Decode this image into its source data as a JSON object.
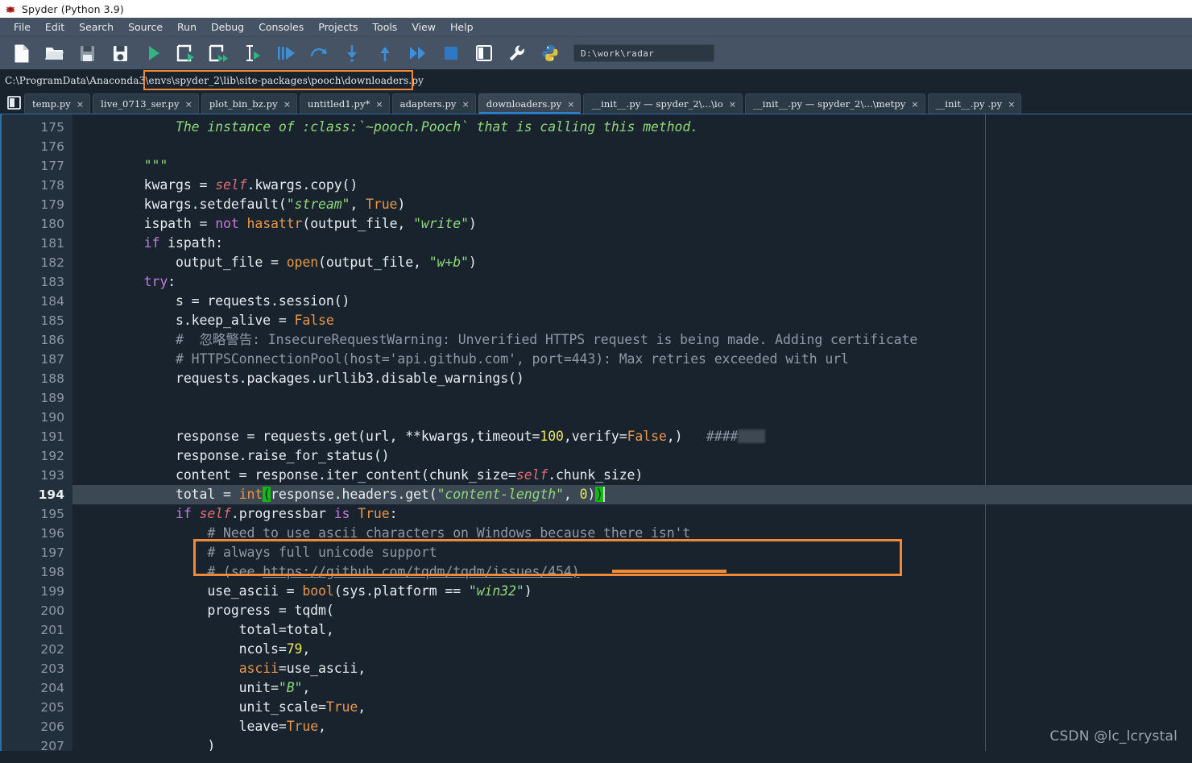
{
  "window": {
    "title": "Spyder (Python 3.9)",
    "logo_icon": "spyder-logo-icon"
  },
  "menubar": {
    "items": [
      {
        "label": "File"
      },
      {
        "label": "Edit"
      },
      {
        "label": "Search"
      },
      {
        "label": "Source"
      },
      {
        "label": "Run"
      },
      {
        "label": "Debug"
      },
      {
        "label": "Consoles"
      },
      {
        "label": "Projects"
      },
      {
        "label": "Tools"
      },
      {
        "label": "View"
      },
      {
        "label": "Help"
      }
    ]
  },
  "toolbar": {
    "buttons": [
      {
        "name": "new-file-icon",
        "title": "New file"
      },
      {
        "name": "open-file-icon",
        "title": "Open file"
      },
      {
        "name": "save-file-icon",
        "title": "Save file"
      },
      {
        "name": "save-all-icon",
        "title": "Save all"
      },
      {
        "name": "run-file-icon",
        "title": "Run file"
      },
      {
        "name": "run-cell-icon",
        "title": "Run current cell"
      },
      {
        "name": "run-cell-advance-icon",
        "title": "Run current cell and go to next one"
      },
      {
        "name": "run-selection-icon",
        "title": "Run selection"
      },
      {
        "name": "debug-file-icon",
        "title": "Debug file"
      },
      {
        "name": "step-over-icon",
        "title": "Run current line"
      },
      {
        "name": "step-into-icon",
        "title": "Step into function"
      },
      {
        "name": "step-return-icon",
        "title": "Run until current function returns"
      },
      {
        "name": "continue-icon",
        "title": "Continue execution"
      },
      {
        "name": "stop-debug-icon",
        "title": "Stop debugging"
      },
      {
        "name": "maximize-pane-icon",
        "title": "Maximize current pane"
      },
      {
        "name": "preferences-icon",
        "title": "Preferences"
      },
      {
        "name": "python-path-manager-icon",
        "title": "PYTHONPATH manager"
      }
    ],
    "working_directory": "D:\\work\\radar"
  },
  "path_strip": {
    "prefix": "C:\\ProgramData\\Anaconda3\\envs",
    "highlighted": "\\spyder_2\\lib\\site-packages\\pooch\\downloaders.py",
    "full": "C:\\ProgramData\\Anaconda3\\envs\\spyder_2\\lib\\site-packages\\pooch\\downloaders.py"
  },
  "tabbar": {
    "browse_icon": "browse-tabs-icon",
    "tabs": [
      {
        "label": "temp.py",
        "active": false,
        "modified": false
      },
      {
        "label": "live_0713_ser.py",
        "active": false,
        "modified": false
      },
      {
        "label": "plot_bin_bz.py",
        "active": false,
        "modified": false
      },
      {
        "label": "untitled1.py*",
        "active": false,
        "modified": true
      },
      {
        "label": "adapters.py",
        "active": false,
        "modified": false
      },
      {
        "label": "downloaders.py",
        "active": true,
        "modified": false
      },
      {
        "label": "__init__.py — spyder_2\\...\\io",
        "active": false,
        "modified": false
      },
      {
        "label": "__init__.py — spyder_2\\...\\metpy",
        "active": false,
        "modified": false
      },
      {
        "label": "__init__.py .py",
        "active": false,
        "modified": false
      }
    ],
    "close_glyph": "×"
  },
  "editor": {
    "first_line": 175,
    "current_line": 194,
    "line_numbers": [
      175,
      176,
      177,
      178,
      179,
      180,
      181,
      182,
      183,
      184,
      185,
      186,
      187,
      188,
      189,
      190,
      191,
      192,
      193,
      194,
      195,
      196,
      197,
      198,
      199,
      200,
      201,
      202,
      203,
      204,
      205,
      206,
      207
    ],
    "lines": [
      {
        "n": 175,
        "text": "            The instance of :class:`~pooch.Pooch` that is calling this method."
      },
      {
        "n": 176,
        "text": ""
      },
      {
        "n": 177,
        "text": "        \"\"\""
      },
      {
        "n": 178,
        "text": "        kwargs = self.kwargs.copy()"
      },
      {
        "n": 179,
        "text": "        kwargs.setdefault(\"stream\", True)"
      },
      {
        "n": 180,
        "text": "        ispath = not hasattr(output_file, \"write\")"
      },
      {
        "n": 181,
        "text": "        if ispath:"
      },
      {
        "n": 182,
        "text": "            output_file = open(output_file, \"w+b\")"
      },
      {
        "n": 183,
        "text": "        try:"
      },
      {
        "n": 184,
        "text": "            s = requests.session()"
      },
      {
        "n": 185,
        "text": "            s.keep_alive = False"
      },
      {
        "n": 186,
        "text": "            #  忽略警告: InsecureRequestWarning: Unverified HTTPS request is being made. Adding certificate"
      },
      {
        "n": 187,
        "text": "            # HTTPSConnectionPool(host='api.github.com', port=443): Max retries exceeded with url"
      },
      {
        "n": 188,
        "text": "            requests.packages.urllib3.disable_warnings()"
      },
      {
        "n": 189,
        "text": ""
      },
      {
        "n": 190,
        "text": ""
      },
      {
        "n": 191,
        "text": "            response = requests.get(url, **kwargs,timeout=100,verify=False,)   ####"
      },
      {
        "n": 192,
        "text": "            response.raise_for_status()"
      },
      {
        "n": 193,
        "text": "            content = response.iter_content(chunk_size=self.chunk_size)"
      },
      {
        "n": 194,
        "text": "            total = int(response.headers.get(\"content-length\", 0))"
      },
      {
        "n": 195,
        "text": "            if self.progressbar is True:"
      },
      {
        "n": 196,
        "text": "                # Need to use ascii characters on Windows because there isn't"
      },
      {
        "n": 197,
        "text": "                # always full unicode support"
      },
      {
        "n": 198,
        "text": "                # (see https://github.com/tqdm/tqdm/issues/454)"
      },
      {
        "n": 199,
        "text": "                use_ascii = bool(sys.platform == \"win32\")"
      },
      {
        "n": 200,
        "text": "                progress = tqdm("
      },
      {
        "n": 201,
        "text": "                    total=total,"
      },
      {
        "n": 202,
        "text": "                    ncols=79,"
      },
      {
        "n": 203,
        "text": "                    ascii=use_ascii,"
      },
      {
        "n": 204,
        "text": "                    unit=\"B\","
      },
      {
        "n": 205,
        "text": "                    unit_scale=True,"
      },
      {
        "n": 206,
        "text": "                    leave=True,"
      },
      {
        "n": 207,
        "text": "                )"
      }
    ],
    "redacted_comment": "####",
    "annotations": [
      {
        "name": "response-line-box",
        "color": "#ee8937",
        "target_line": 191
      },
      {
        "name": "timeout-underline",
        "color": "#ee8937",
        "target_text": "timeout=100"
      },
      {
        "name": "path-highlight-box",
        "color": "#ee8937",
        "target_text": "\\spyder_2\\lib\\site-packages\\pooch\\downloaders.py"
      }
    ]
  },
  "watermark": {
    "text": "CSDN @lc_lcrystal"
  },
  "colors": {
    "window_bg": "#19232d",
    "chrome_bg": "#455364",
    "gutter_bg": "#21303c",
    "current_line_bg": "#3c4854",
    "accent_blue": "#2a7fcf",
    "annotation_orange": "#ee8937",
    "text": "#e7ecf1",
    "comment": "#8d99a5",
    "string": "#8fd87a",
    "number": "#e8e45a",
    "keyword": "#c678dd",
    "builtin": "#e8974b",
    "self": "#e06c75",
    "bracket_match": "#10bb10"
  }
}
